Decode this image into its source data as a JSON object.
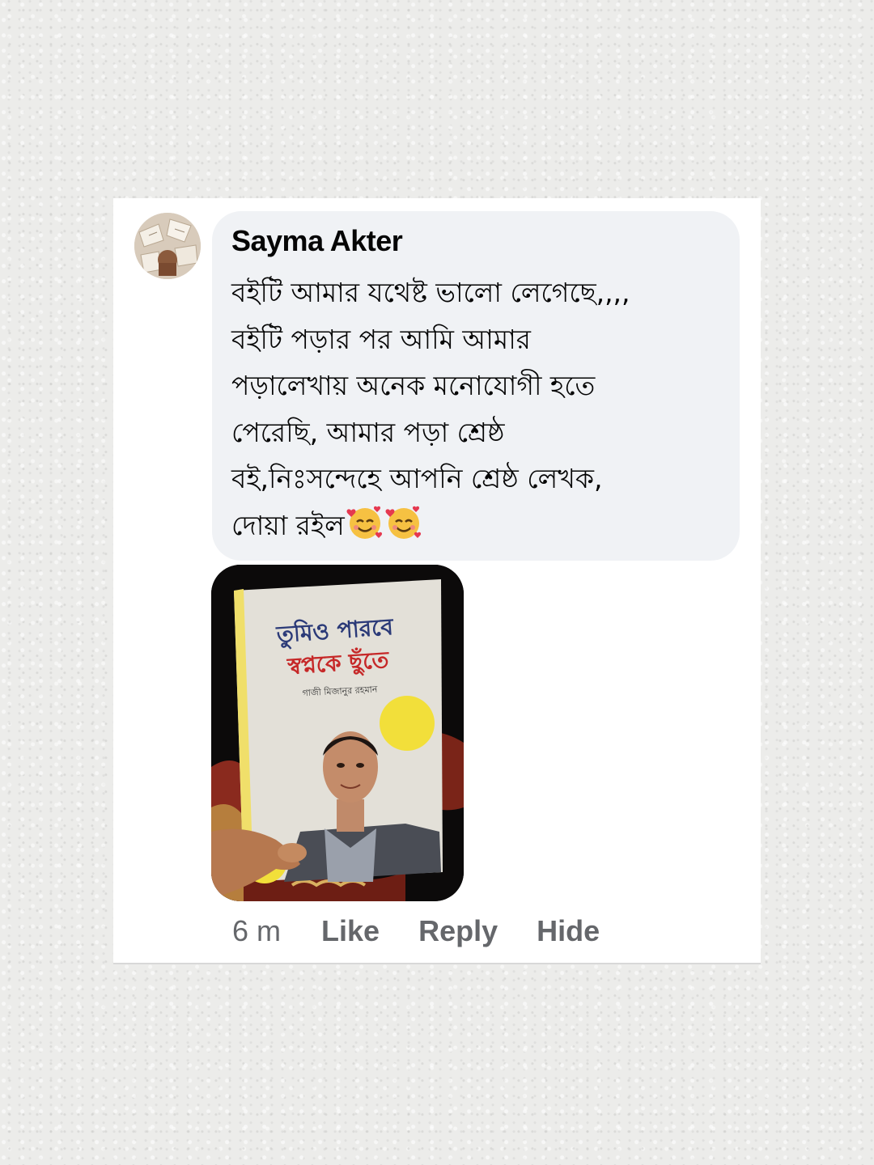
{
  "comment": {
    "author": "Sayma Akter",
    "text": "বইটি আমার যথেষ্ট ভালো লেগেছে,,,,\nবইটি পড়ার পর আমি আমার\nপড়ালেখায় অনেক মনোযোগী হতে\nপেরেছি, আমার পড়া শ্রেষ্ঠ\nবই,নিঃসন্দেহে আপনি শ্রেষ্ঠ লেখক,\nদোয়া রইল",
    "emojis": [
      "smiling-face-with-hearts",
      "smiling-face-with-hearts"
    ],
    "time": "6 m",
    "actions": {
      "like": "Like",
      "reply": "Reply",
      "hide": "Hide"
    }
  },
  "attachment": {
    "book_title_line1": "তুমিও পারবে",
    "book_title_line2": "স্বপ্নকে ছুঁতে",
    "book_author": "গাজী মিজানুর রহমান"
  },
  "colors": {
    "bubble": "#f0f2f5",
    "text": "#050505",
    "secondary_text": "#65676b",
    "card": "#ffffff",
    "page_background": "#ececea"
  }
}
